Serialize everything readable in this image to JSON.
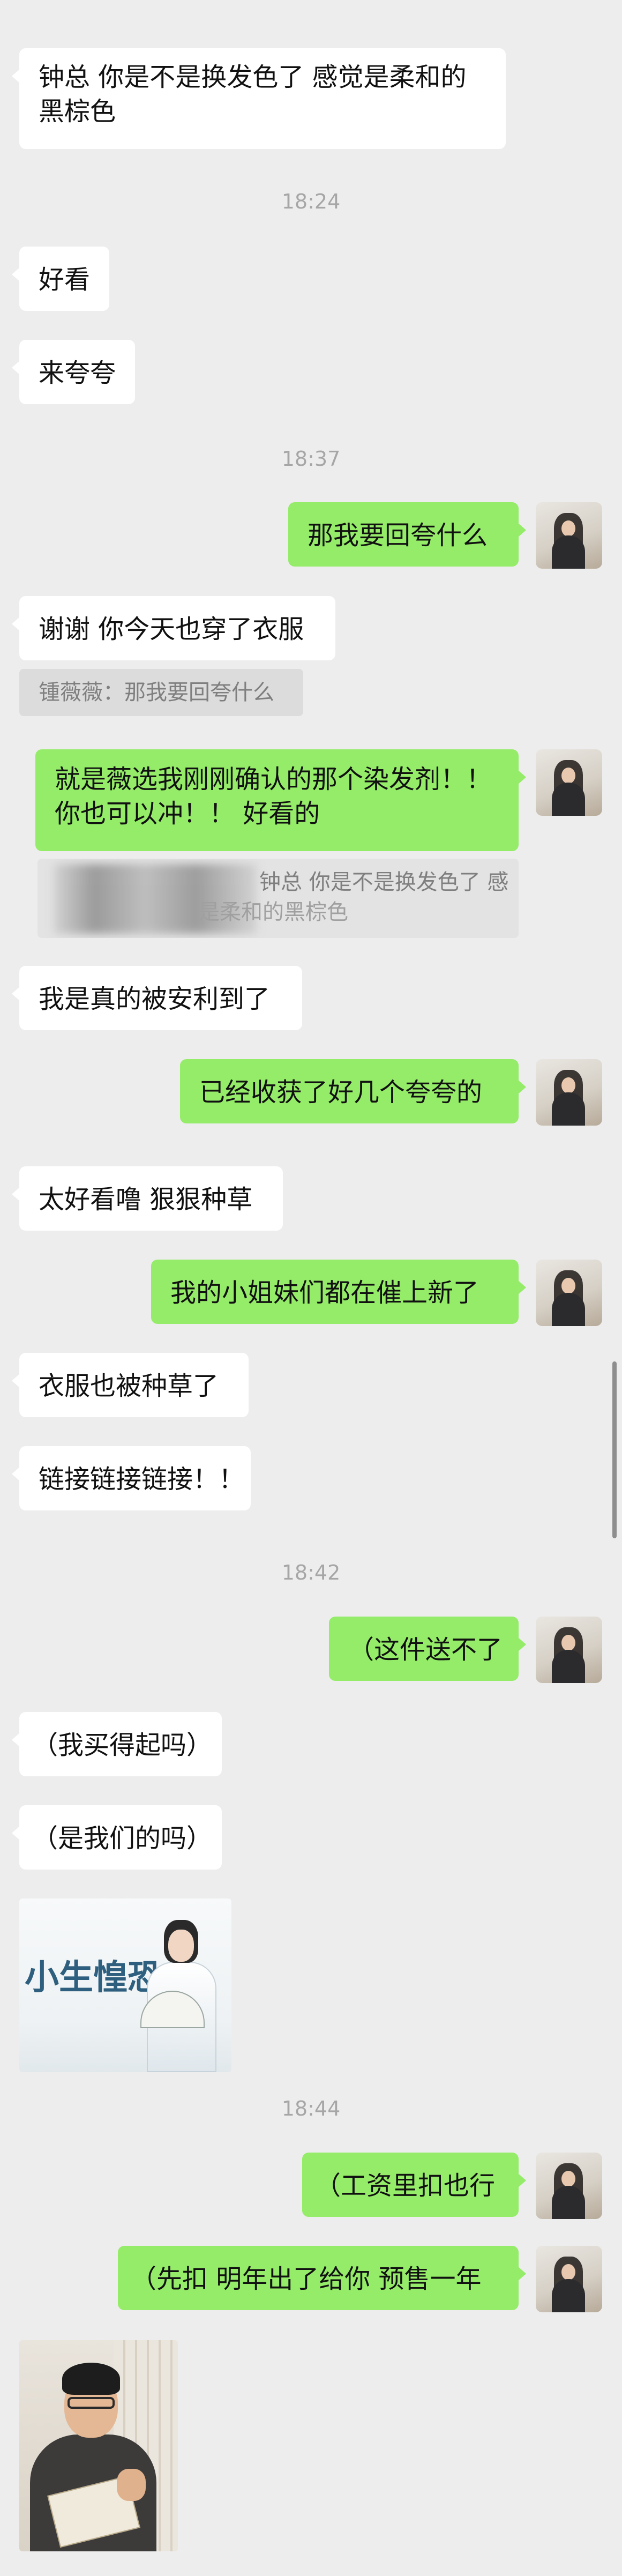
{
  "timestamps": {
    "t1": "18:24",
    "t2": "18:37",
    "t3": "18:42",
    "t4": "18:44"
  },
  "messages": {
    "m1_line1": "钟总 你是不是换发色了 感觉是柔和的",
    "m1_line2": "黑棕色",
    "m2": "好看",
    "m3": "来夸夸",
    "m4": "那我要回夸什么",
    "m5": "谢谢 你今天也穿了衣服",
    "m5_quote": "锺薇薇：那我要回夸什么",
    "m6_line1": "就是薇选我刚刚确认的那个染发剂！！",
    "m6_line2": "你也可以冲！！ 好看的",
    "m6_quote_line1": "钟总 你是不是换发色了 感",
    "m6_quote_line2": "是柔和的黑棕色",
    "m7": "我是真的被安利到了",
    "m8": "已经收获了好几个夸夸的",
    "m9": "太好看噜 狠狠种草",
    "m10": "我的小姐妹们都在催上新了",
    "m11": "衣服也被种草了",
    "m12": "链接链接链接！！",
    "m13": "（这件送不了",
    "m14": "（我买得起吗）",
    "m15": "（是我们的吗）",
    "sticker_text": "小生惶恐",
    "m16": "（工资里扣也行",
    "m17": "（先扣 明年出了给你  预售一年"
  },
  "colors": {
    "background": "#ededed",
    "bubble_self": "#95ec69",
    "bubble_other": "#ffffff",
    "timestamp": "#a6a6a6"
  }
}
